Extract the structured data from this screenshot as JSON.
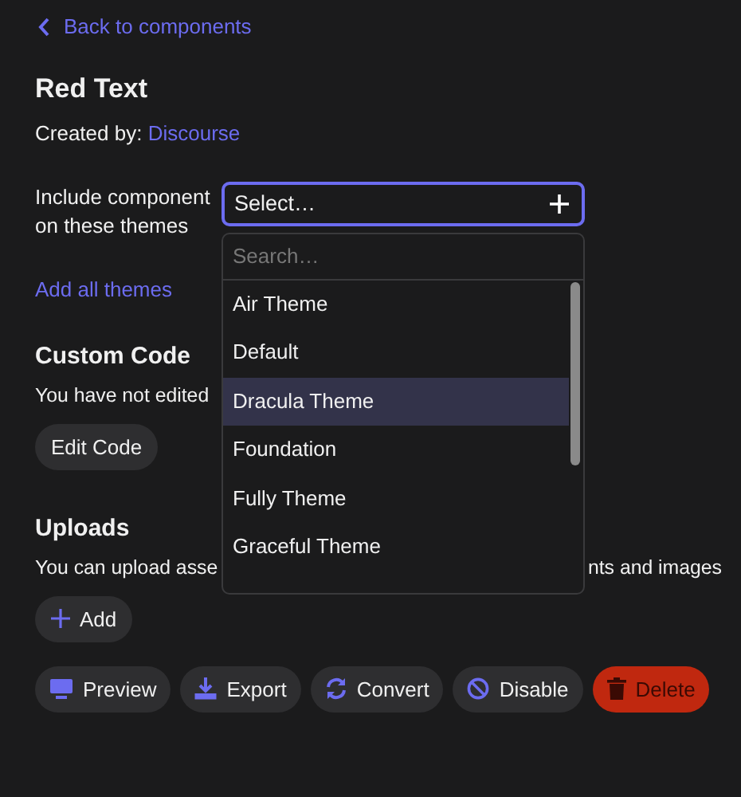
{
  "back_link": "Back to components",
  "title": "Red Text",
  "created_by": {
    "label": "Created by:",
    "author": "Discourse"
  },
  "themes_field": {
    "label": "Include component on these themes",
    "placeholder": "Select…",
    "add_all": "Add all themes",
    "dropdown": {
      "search_placeholder": "Search…",
      "options": [
        {
          "label": "Air Theme",
          "selected": false
        },
        {
          "label": "Default",
          "selected": false
        },
        {
          "label": "Dracula Theme",
          "selected": true
        },
        {
          "label": "Foundation",
          "selected": false
        },
        {
          "label": "Fully Theme",
          "selected": false
        },
        {
          "label": "Graceful Theme",
          "selected": false
        }
      ]
    }
  },
  "custom_code": {
    "heading": "Custom Code",
    "text_parts": [
      "You have not edited"
    ],
    "button": "Edit Code"
  },
  "uploads": {
    "heading": "Uploads",
    "text_parts": [
      "You can upload asse",
      "nts and images"
    ],
    "button": "Add"
  },
  "actions": [
    {
      "kind": "preview",
      "label": "Preview"
    },
    {
      "kind": "export",
      "label": "Export"
    },
    {
      "kind": "convert",
      "label": "Convert"
    },
    {
      "kind": "disable",
      "label": "Disable"
    },
    {
      "kind": "delete",
      "label": "Delete"
    }
  ]
}
